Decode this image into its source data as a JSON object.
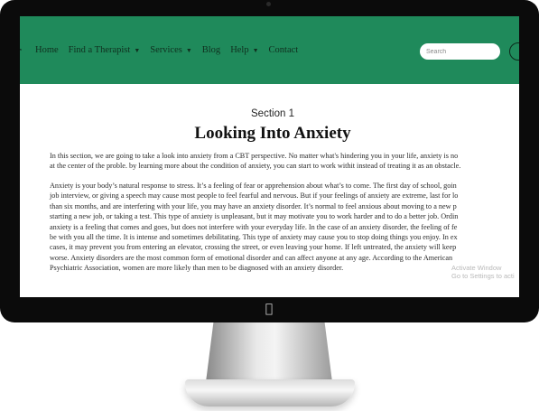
{
  "nav": {
    "brand_fragment": "r",
    "items": [
      {
        "label": "Home",
        "dropdown": false
      },
      {
        "label": "Find a Therapist",
        "dropdown": true
      },
      {
        "label": "Services",
        "dropdown": true
      },
      {
        "label": "Blog",
        "dropdown": false
      },
      {
        "label": "Help",
        "dropdown": true
      },
      {
        "label": "Contact",
        "dropdown": false
      }
    ],
    "caret": "▼",
    "search_placeholder": "Search"
  },
  "section": {
    "label": "Section 1",
    "title": "Looking Into Anxiety"
  },
  "paragraph1": [
    "In this section, we are going to take a look into anxiety from a CBT perspective. No matter what's hindering you in your life, anxiety is no",
    "at the center of the proble. by learning more about the condition of anxiety, you can start to work withit instead of treating it as an obstacle."
  ],
  "paragraph2": [
    "Anxiety is your body’s natural response to stress. It’s a feeling of fear or apprehension about what’s to come. The first day of school, goin",
    "job interview, or giving a speech may cause most people to feel fearful and nervous. But if your feelings of anxiety are extreme, last for lo",
    "than six months, and are interfering with your life, you may have an anxiety disorder. It’s normal to feel anxious about moving to a new p",
    "starting a new job, or taking a test. This type of anxiety is unpleasant, but it may motivate you to work harder and to do a better job. Ordin",
    "anxiety is a feeling that comes and goes, but does not interfere with your everyday life. In the case of an anxiety disorder, the feeling of fe",
    "be with you all the time. It is intense and sometimes debilitating. This type of anxiety may cause you to stop doing things you enjoy. In ex",
    "cases, it may prevent you from entering an elevator, crossing the street, or even leaving your home. If left untreated, the anxiety will keep",
    "worse. Anxiety disorders are the most common form of emotional disorder and can affect anyone at any age. According to the American",
    "Psychiatric Association, women are more likely than men to be diagnosed with an anxiety disorder."
  ],
  "watermark": {
    "line1": "Activate Window",
    "line2": "Go to Settings to acti"
  },
  "colors": {
    "navbar": "#1f8a5b",
    "bezel": "#0b0b0b"
  }
}
